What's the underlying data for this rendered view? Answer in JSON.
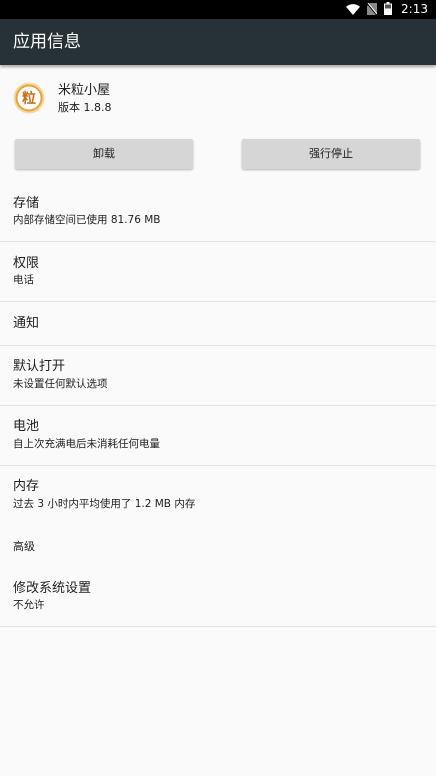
{
  "status_bar": {
    "time": "2:13",
    "icons": [
      "wifi-icon",
      "no-sim-icon",
      "battery-icon"
    ]
  },
  "app_bar": {
    "title": "应用信息"
  },
  "app": {
    "name": "米粒小屋",
    "version": "版本 1.8.8",
    "icon_glyph": "粒"
  },
  "buttons": {
    "uninstall": "卸载",
    "force_stop": "强行停止"
  },
  "prefs": {
    "storage": {
      "title": "存储",
      "summary": "内部存储空间已使用 81.76 MB"
    },
    "permissions": {
      "title": "权限",
      "summary": "电话"
    },
    "notifications": {
      "title": "通知"
    },
    "open_by_default": {
      "title": "默认打开",
      "summary": "未设置任何默认选项"
    },
    "battery": {
      "title": "电池",
      "summary": "自上次充满电后未消耗任何电量"
    },
    "memory": {
      "title": "内存",
      "summary": "过去 3 小时内平均使用了 1.2 MB 内存"
    },
    "advanced": {
      "title": "高级"
    },
    "modify_system_settings": {
      "title": "修改系统设置",
      "summary": "不允许"
    }
  },
  "colors": {
    "status_bar": "#000000",
    "app_bar": "#263238",
    "background": "#fafafa",
    "button": "#d6d6d6",
    "divider": "#e0e0e0",
    "app_icon_accent": "#e8a33c"
  }
}
